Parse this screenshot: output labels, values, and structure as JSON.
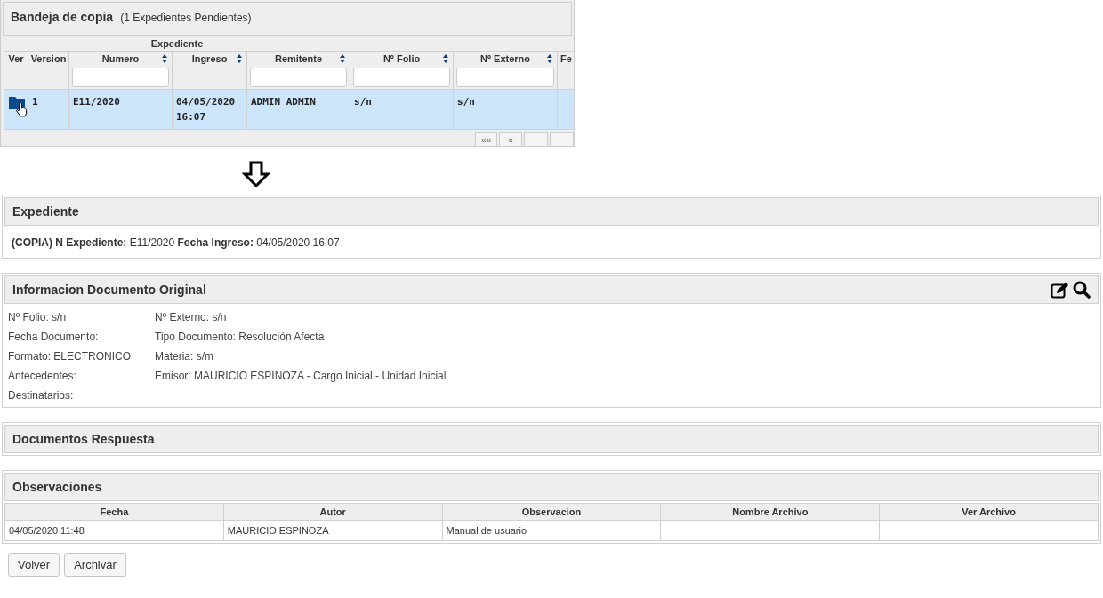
{
  "inbox": {
    "title": "Bandeja de copia",
    "count": "(1 Expedientes Pendientes)",
    "group_header": "Expediente",
    "columns": [
      {
        "label": "Ver",
        "sortable": false,
        "filter": false
      },
      {
        "label": "Version",
        "sortable": false,
        "filter": false
      },
      {
        "label": "Numero",
        "sortable": true,
        "filter": true
      },
      {
        "label": "Ingreso",
        "sortable": true,
        "filter": false
      },
      {
        "label": "Remitente",
        "sortable": true,
        "filter": true
      },
      {
        "label": "Nº Folio",
        "sortable": true,
        "filter": true
      },
      {
        "label": "Nº Externo",
        "sortable": true,
        "filter": true
      },
      {
        "label": "Fe",
        "filter": false
      }
    ],
    "rows": [
      {
        "selected": true,
        "cells": [
          "",
          "1",
          "E11/2020",
          "04/05/2020 16:07",
          "ADMIN ADMIN",
          "s/n",
          "s/n"
        ]
      }
    ],
    "pager": [
      "««",
      "«"
    ]
  },
  "expediente": {
    "title": "Expediente",
    "summary": "**(COPIA) N Expediente:** E11/2020 **Fecha Ingreso:** 04/05/2020 16:07"
  },
  "documento_original": {
    "title": "Informacion Documento Original",
    "rows": [
      {
        "left": "Nº Folio: s/n",
        "right": "Nº Externo: s/n"
      },
      {
        "left": "Fecha Documento:",
        "right": "Tipo Documento: Resolución Afecta"
      },
      {
        "left": "Formato: ELECTRONICO",
        "right": "Materia: s/m"
      },
      {
        "left": "Antecedentes:",
        "right": "Emisor: MAURICIO ESPINOZA - Cargo Inicial - Unidad Inicial"
      },
      {
        "left": "Destinatarios:"
      }
    ]
  },
  "documentos_respuesta": {
    "title": "Documentos Respuesta"
  },
  "observaciones": {
    "title": "Observaciones",
    "columns": [
      "Fecha",
      "Autor",
      "Observacion",
      "Nombre Archivo",
      "Ver Archivo"
    ],
    "rows": [
      [
        "04/05/2020 11:48",
        "MAURICIO ESPINOZA",
        "Manual de usuario",
        "",
        ""
      ]
    ]
  },
  "buttons": [
    "Volver",
    "Archivar"
  ]
}
